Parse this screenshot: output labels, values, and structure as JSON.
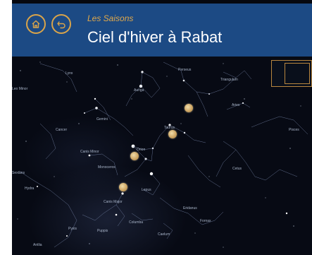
{
  "header": {
    "subtitle": "Les Saisons",
    "title": "Ciel d'hiver à Rabat",
    "accent_color": "#d9a44a",
    "background_color": "#1c4a84",
    "home_icon": "home-icon",
    "back_icon": "back-arrow-icon"
  },
  "sky_map": {
    "background_color": "#070a14",
    "constellations": [
      {
        "id": "lynx",
        "label": "Lynx"
      },
      {
        "id": "perseus",
        "label": "Perseus"
      },
      {
        "id": "triangulum",
        "label": "Triangulum"
      },
      {
        "id": "leo-minor",
        "label": "Leo Minor"
      },
      {
        "id": "auriga",
        "label": "Auriga"
      },
      {
        "id": "aries",
        "label": "Aries"
      },
      {
        "id": "gemini",
        "label": "Gemini"
      },
      {
        "id": "taurus",
        "label": "Taurus"
      },
      {
        "id": "cancer",
        "label": "Cancer"
      },
      {
        "id": "pisces",
        "label": "Pisces"
      },
      {
        "id": "orion",
        "label": "Orion"
      },
      {
        "id": "canis-minor",
        "label": "Canis Minor"
      },
      {
        "id": "monoceros",
        "label": "Monoceros"
      },
      {
        "id": "cetus",
        "label": "Cetus"
      },
      {
        "id": "hydra",
        "label": "Hydra"
      },
      {
        "id": "lepus",
        "label": "Lepus"
      },
      {
        "id": "canis-major",
        "label": "Canis Major"
      },
      {
        "id": "eridanus",
        "label": "Eridanus"
      },
      {
        "id": "fornax",
        "label": "Fornax"
      },
      {
        "id": "columba",
        "label": "Columba"
      },
      {
        "id": "pyxis",
        "label": "Pyxis"
      },
      {
        "id": "puppis",
        "label": "Puppis"
      },
      {
        "id": "caelum",
        "label": "Caelum"
      },
      {
        "id": "antlia",
        "label": "Antlia"
      },
      {
        "id": "sextans",
        "label": "Sextans"
      }
    ],
    "planet_markers": [
      "planet-marker-1",
      "planet-marker-2",
      "planet-marker-3",
      "planet-marker-4"
    ]
  }
}
